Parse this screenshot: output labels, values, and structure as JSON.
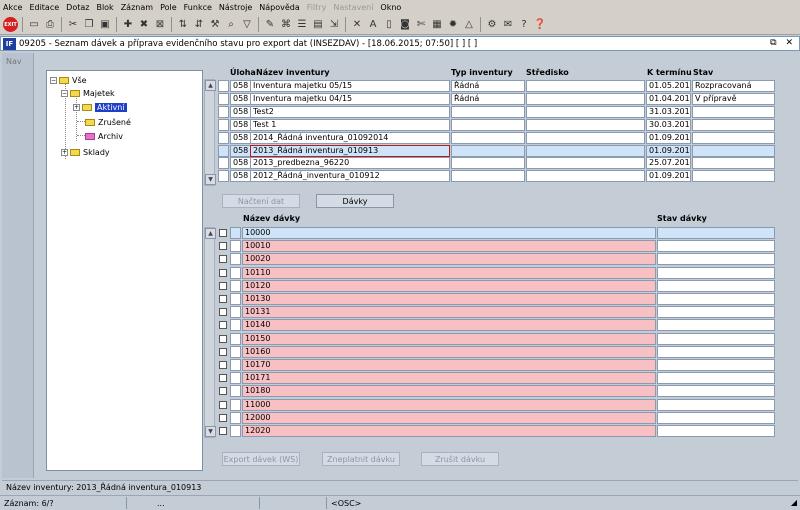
{
  "menu": [
    "Akce",
    "Editace",
    "Dotaz",
    "Blok",
    "Záznam",
    "Pole",
    "Funkce",
    "Nástroje",
    "Nápověda",
    "Filtry",
    "Nastavení",
    "Okno"
  ],
  "menu_disabled": [
    "Filtry",
    "Nastavení"
  ],
  "toolbar_icons": [
    "exit-icon",
    "save-icon",
    "print-icon",
    "cut-icon",
    "copy-icon",
    "paste-icon",
    "new-record-icon",
    "delete-record-icon",
    "lock-icon",
    "first-record-icon",
    "sort-icon",
    "tools-icon",
    "search-icon",
    "filter-icon",
    "note-icon",
    "attach-icon",
    "list-icon",
    "clipboard-icon",
    "export-icon",
    "document-icon",
    "cross-icon",
    "text-icon",
    "camera-icon",
    "scissors-icon",
    "grid-icon",
    "sun-icon",
    "warning-icon",
    "tool-icon",
    "mail-icon",
    "help-icon",
    "help-question-icon"
  ],
  "window": {
    "logo": "IF",
    "title": "09205 - Seznam dávek a příprava evidenčního stavu pro export dat (INSEZDAV) - [18.06.2015; 07:50]  [ ]  [ ]",
    "controls": "⧉ ✕"
  },
  "nav": {
    "label": "Nav"
  },
  "tree": {
    "nodes": [
      {
        "label": "Vše"
      },
      {
        "label": "Majetek"
      },
      {
        "label": "Aktivní"
      },
      {
        "label": "Zrušené"
      },
      {
        "label": "Archiv"
      },
      {
        "label": "Sklady"
      }
    ]
  },
  "inventory": {
    "columns": {
      "uloha": "Úloha",
      "nazev": "Název inventury",
      "typ": "Typ inventury",
      "stredisko": "Středisko",
      "termin": "K termínu",
      "stav": "Stav"
    },
    "rows": [
      {
        "uloha": "058",
        "nazev": "Inventura majetku 05/15",
        "typ": "Řádná",
        "stredisko": "",
        "termin": "01.05.2015",
        "stav": "Rozpracovaná"
      },
      {
        "uloha": "058",
        "nazev": "Inventura majetku 04/15",
        "typ": "Řádná",
        "stredisko": "",
        "termin": "01.04.2015",
        "stav": "V přípravě"
      },
      {
        "uloha": "058",
        "nazev": "Test2",
        "typ": "",
        "stredisko": "",
        "termin": "31.03.2015",
        "stav": ""
      },
      {
        "uloha": "058",
        "nazev": "Test 1",
        "typ": "",
        "stredisko": "",
        "termin": "30.03.2015",
        "stav": ""
      },
      {
        "uloha": "058",
        "nazev": "2014_Řádná inventura_01092014",
        "typ": "",
        "stredisko": "",
        "termin": "01.09.2014",
        "stav": ""
      },
      {
        "uloha": "058",
        "nazev": "2013_Řádná inventura_010913",
        "typ": "",
        "stredisko": "",
        "termin": "01.09.2013",
        "stav": ""
      },
      {
        "uloha": "058",
        "nazev": "2013_predbezna_96220",
        "typ": "",
        "stredisko": "",
        "termin": "25.07.2013",
        "stav": ""
      },
      {
        "uloha": "058",
        "nazev": "2012_Řádná_inventura_010912",
        "typ": "",
        "stredisko": "",
        "termin": "01.09.2012",
        "stav": ""
      }
    ]
  },
  "buttons": {
    "nacteni": "Načtení dat",
    "davky": "Dávky",
    "export": "Export dávek (WS)",
    "zneplatnit": "Zneplatnit dávku",
    "zrusit": "Zrušit dávku"
  },
  "batches": {
    "columns": {
      "nazev": "Název dávky",
      "stav": "Stav dávky"
    },
    "rows": [
      "10000",
      "10010",
      "10020",
      "10110",
      "10120",
      "10130",
      "10131",
      "10140",
      "10150",
      "10160",
      "10170",
      "10171",
      "10180",
      "11000",
      "12000",
      "12020"
    ]
  },
  "status": {
    "message": "Název inventury: 2013_Řádná inventura_010913",
    "record": "Záznam: 6/?",
    "dots": "...",
    "osc": "<OSC>"
  },
  "colors": {
    "pink_row": "#f9c0c3",
    "selected_row": "#cfe4f8",
    "tree_selected": "#1e3fc8"
  }
}
